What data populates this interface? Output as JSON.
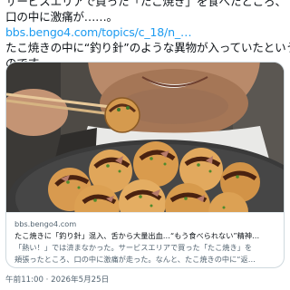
{
  "post": {
    "line1": "サービスエリアで買った「たこ焼き」を食べたところ、",
    "line2": "口の中に激痛が……。",
    "link": "bbs.bengo4.com/topics/c_18/n_…",
    "line3": "たこ焼きの中に“釣り針”のような異物が入っていたという",
    "line4": "のです。"
  },
  "card": {
    "image_alt": "man-eating-takoyaki",
    "domain": "bbs.bengo4.com",
    "title": "たこ焼きに「釣り針」混入、舌から大量出血…“もう食べられない”精神…",
    "description_1": "「熱い！」では済まなかった。サービスエリアで買った「たこ焼き」を",
    "description_2": "頬張ったところ、口の中に激痛が走った。なんと、たこ焼きの中に“返…"
  },
  "meta": {
    "timestamp": "午前11:00 · 2026年5月25日"
  },
  "colors": {
    "link": "#1d9bf0",
    "text": "#0f1419",
    "secondary": "#536471",
    "border": "#cfd9de"
  }
}
